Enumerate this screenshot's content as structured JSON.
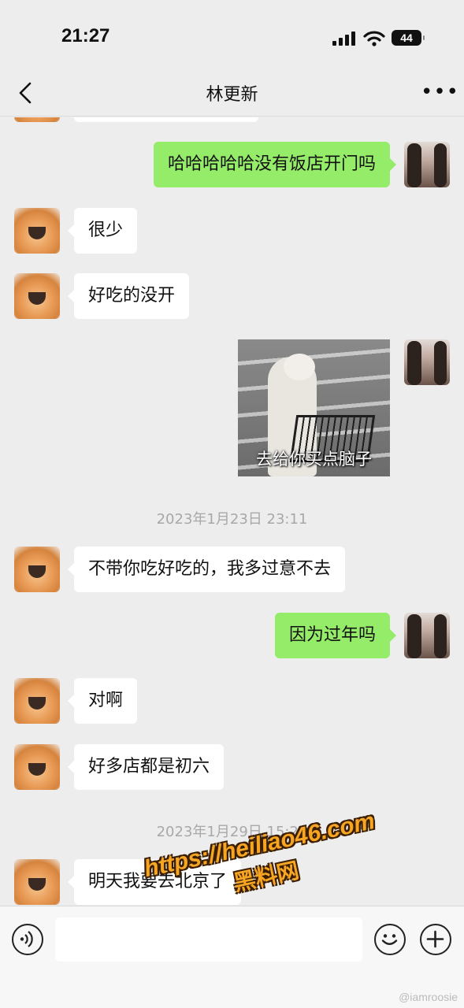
{
  "status_bar": {
    "time": "21:27",
    "battery": "44"
  },
  "nav": {
    "title": "林更新",
    "more": "•••"
  },
  "messages": [
    {
      "text": "哈哈哈哈哈没有饭店开门吗"
    },
    {
      "text": "很少"
    },
    {
      "text": "好吃的没开"
    },
    {
      "sticker_caption": "去给你买点脑子"
    },
    {
      "text": "不带你吃好吃的，我多过意不去"
    },
    {
      "text": "因为过年吗"
    },
    {
      "text": "对啊"
    },
    {
      "text": "好多店都是初六"
    },
    {
      "text": "明天我要去北京了"
    }
  ],
  "timestamps": [
    "2023年1月23日 23:11",
    "2023年1月29日 15:27"
  ],
  "watermark": {
    "url": "https://heiliao46.com",
    "name": "黑料网",
    "weibo": "@iamroosie"
  },
  "input": {
    "placeholder": ""
  }
}
